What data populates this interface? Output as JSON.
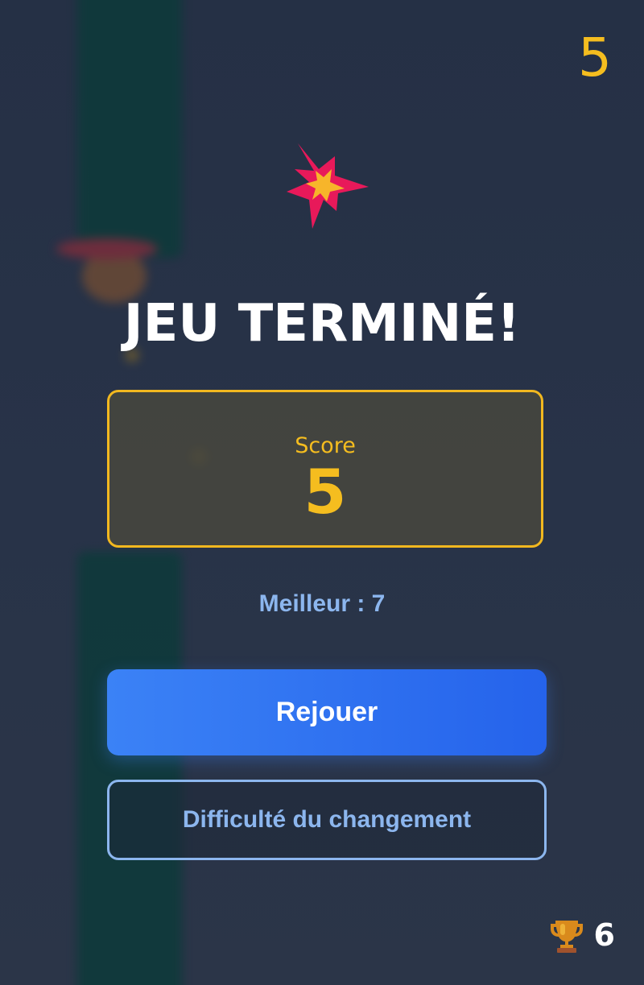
{
  "hud": {
    "current_score": "5",
    "best_score": "6",
    "trophy_icon": "trophy-icon"
  },
  "game_over": {
    "icon": "explosion-icon",
    "title": "JEU TERMINÉ!",
    "score_label": "Score",
    "score_value": "5",
    "best_text": "Meilleur : 7",
    "replay_label": "Rejouer",
    "difficulty_label": "Difficulté du changement"
  },
  "colors": {
    "accent_gold": "#f5bd1f",
    "primary_blue": "#3b82f6",
    "light_blue": "#8cb6ee",
    "background": "#273245",
    "explosion_pink": "#e8195a"
  }
}
